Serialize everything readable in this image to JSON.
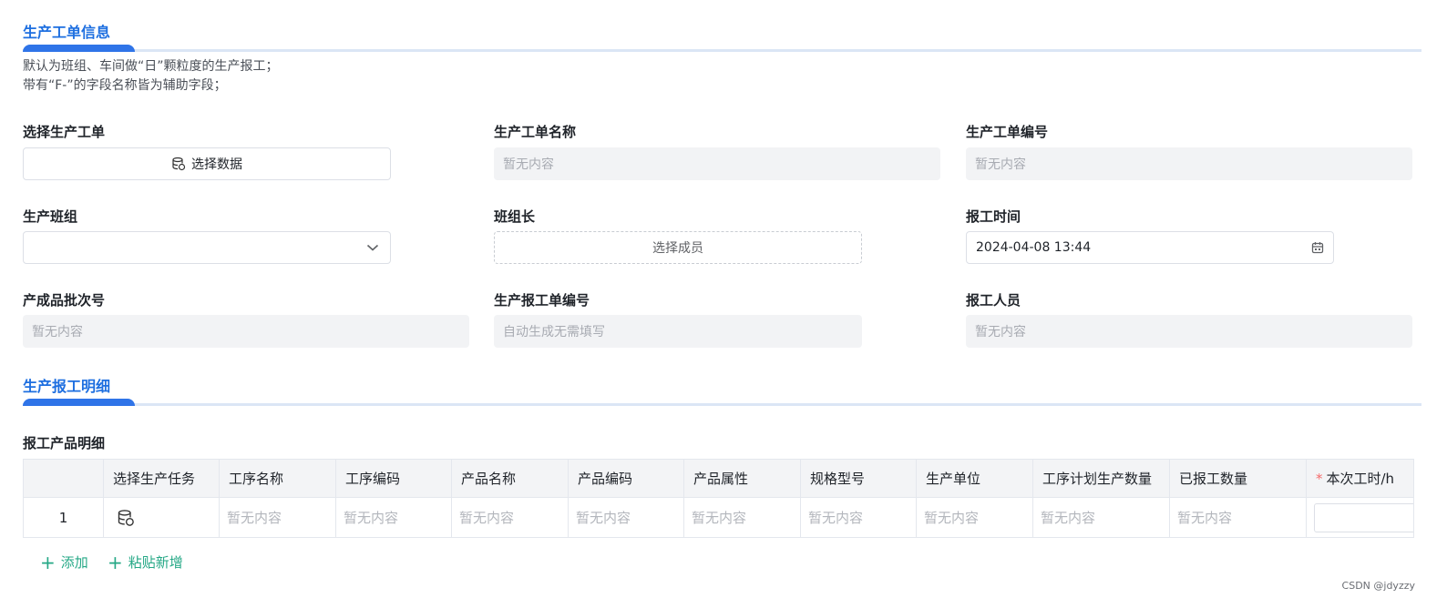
{
  "section1": {
    "title": "生产工单信息"
  },
  "description": [
    "默认为班组、车间做“日”颗粒度的生产报工；",
    "带有“F-”的字段名称皆为辅助字段；"
  ],
  "fields": {
    "select_order": {
      "label": "选择生产工单",
      "button": "选择数据"
    },
    "order_name": {
      "label": "生产工单名称",
      "placeholder": "暂无内容"
    },
    "order_code": {
      "label": "生产工单编号",
      "placeholder": "暂无内容"
    },
    "team": {
      "label": "生产班组",
      "value": ""
    },
    "team_leader": {
      "label": "班组长",
      "button": "选择成员"
    },
    "report_time": {
      "label": "报工时间",
      "value": "2024-04-08 13:44"
    },
    "batch_no": {
      "label": "产成品批次号",
      "placeholder": "暂无内容"
    },
    "report_code": {
      "label": "生产报工单编号",
      "placeholder": "自动生成无需填写"
    },
    "reporter": {
      "label": "报工人员",
      "placeholder": "暂无内容"
    }
  },
  "section2": {
    "title": "生产报工明细"
  },
  "detail_table": {
    "label": "报工产品明细",
    "columns": [
      "",
      "选择生产任务",
      "工序名称",
      "工序编码",
      "产品名称",
      "产品编码",
      "产品属性",
      "规格型号",
      "生产单位",
      "工序计划生产数量",
      "已报工数量",
      "本次工时/h"
    ],
    "rows": [
      {
        "index": "1",
        "cells": [
          "暂无内容",
          "暂无内容",
          "暂无内容",
          "暂无内容",
          "暂无内容",
          "暂无内容",
          "暂无内容",
          "暂无内容",
          "暂无内容"
        ]
      }
    ]
  },
  "actions": {
    "add": "添加",
    "paste_add": "粘贴新增"
  },
  "watermark": "CSDN @jdyzzy",
  "colors": {
    "accent": "#2f74e8",
    "title": "#1e6fe0",
    "link": "#25a886",
    "required": "#f56c6c"
  }
}
